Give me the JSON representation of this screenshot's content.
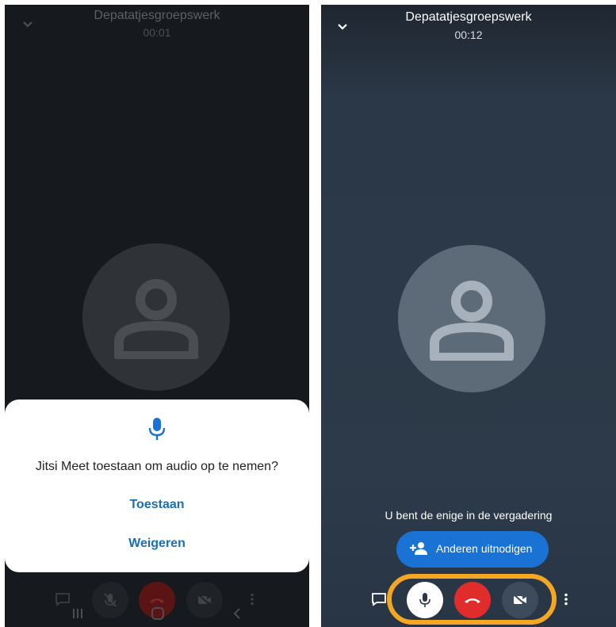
{
  "left_screen": {
    "meeting_title": "Depatatjesgroepswerk",
    "timer": "00:01",
    "dialog": {
      "icon": "mic-icon",
      "message": "Jitsi Meet toestaan om audio op te nemen?",
      "allow_label": "Toestaan",
      "deny_label": "Weigeren"
    },
    "toolbar": [
      "chat-icon",
      "mic-muted-icon",
      "hangup-icon",
      "video-off-icon",
      "more-icon"
    ],
    "nav_bar": [
      "recent-apps-icon",
      "home-icon",
      "back-icon"
    ]
  },
  "right_screen": {
    "meeting_title": "Depatatjesgroepswerk",
    "timer": "00:12",
    "status_text": "U bent de enige in de vergadering",
    "invite_label": "Anderen uitnodigen",
    "toolbar": [
      "chat-icon",
      "mic-icon",
      "hangup-icon",
      "video-off-icon",
      "more-icon"
    ],
    "highlight_color": "#f5a623"
  },
  "colors": {
    "accent_blue": "#1a73d4",
    "hangup_red": "#e12c2c"
  }
}
